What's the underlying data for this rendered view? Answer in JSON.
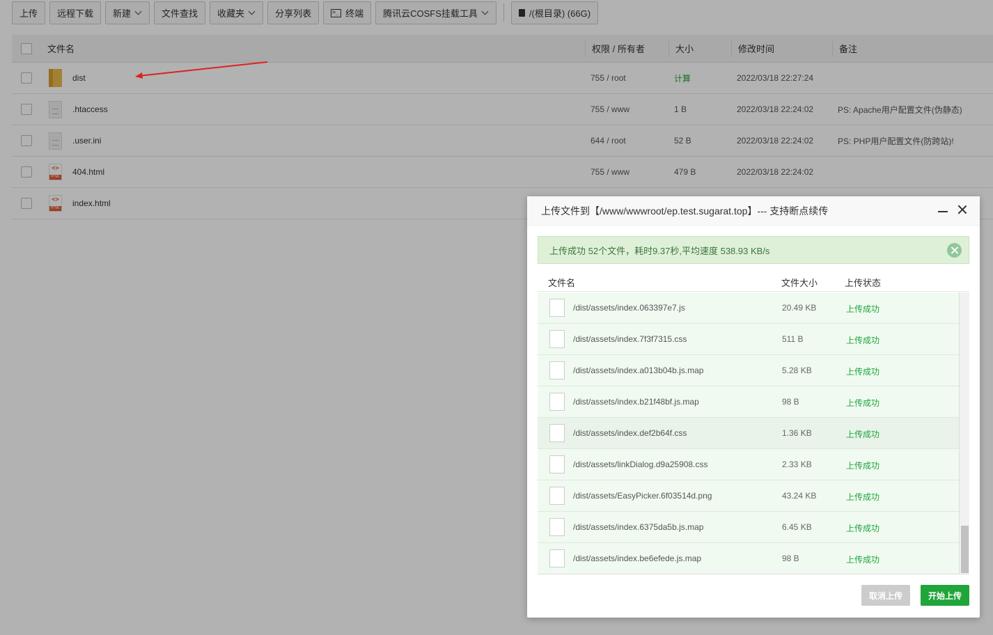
{
  "toolbar": {
    "upload": "上传",
    "remote_download": "远程下载",
    "new": "新建",
    "file_search": "文件查找",
    "favorites": "收藏夹",
    "share_list": "分享列表",
    "terminal": "终端",
    "cosfs": "腾讯云COSFS挂载工具",
    "disk": "/(根目录) (66G)"
  },
  "table": {
    "headers": {
      "name": "文件名",
      "perm": "权限 / 所有者",
      "size": "大小",
      "mtime": "修改时间",
      "note": "备注"
    },
    "rows": [
      {
        "name": "dist",
        "icon": "folder-icon",
        "perm": "755 / root",
        "size": "计算",
        "mtime": "2022/03/18 22:27:24",
        "note": ""
      },
      {
        "name": ".htaccess",
        "icon": "document-icon",
        "perm": "755 / www",
        "size": "1 B",
        "mtime": "2022/03/18 22:24:02",
        "note": "PS: Apache用户配置文件(伪静态)"
      },
      {
        "name": ".user.ini",
        "icon": "document-icon",
        "perm": "644 / root",
        "size": "52 B",
        "mtime": "2022/03/18 22:24:02",
        "note": "PS: PHP用户配置文件(防跨站)!"
      },
      {
        "name": "404.html",
        "icon": "html-file-icon",
        "perm": "755 / www",
        "size": "479 B",
        "mtime": "2022/03/18 22:24:02",
        "note": ""
      },
      {
        "name": "index.html",
        "icon": "html-file-icon",
        "perm": "",
        "size": "",
        "mtime": "",
        "note": ""
      }
    ]
  },
  "modal": {
    "title": "上传文件到【/www/wwwroot/ep.test.sugarat.top】--- 支持断点续传",
    "success_message": "上传成功 52个文件，耗时9.37秒,平均速度 538.93 KB/s",
    "headers": {
      "name": "文件名",
      "size": "文件大小",
      "status": "上传状态"
    },
    "files": [
      {
        "name": "/dist/assets/index.063397e7.js",
        "size": "20.49 KB",
        "status": "上传成功"
      },
      {
        "name": "/dist/assets/index.7f3f7315.css",
        "size": "511 B",
        "status": "上传成功"
      },
      {
        "name": "/dist/assets/index.a013b04b.js.map",
        "size": "5.28 KB",
        "status": "上传成功"
      },
      {
        "name": "/dist/assets/index.b21f48bf.js.map",
        "size": "98 B",
        "status": "上传成功"
      },
      {
        "name": "/dist/assets/index.def2b64f.css",
        "size": "1.36 KB",
        "status": "上传成功"
      },
      {
        "name": "/dist/assets/linkDialog.d9a25908.css",
        "size": "2.33 KB",
        "status": "上传成功"
      },
      {
        "name": "/dist/assets/EasyPicker.6f03514d.png",
        "size": "43.24 KB",
        "status": "上传成功"
      },
      {
        "name": "/dist/assets/index.6375da5b.js.map",
        "size": "6.45 KB",
        "status": "上传成功"
      },
      {
        "name": "/dist/assets/index.be6efede.js.map",
        "size": "98 B",
        "status": "上传成功"
      }
    ],
    "cancel_label": "取消上传",
    "start_label": "开始上传"
  },
  "colors": {
    "accent": "#20a53a",
    "success_bg": "#dff0d8",
    "annotation_arrow": "#e02020"
  }
}
